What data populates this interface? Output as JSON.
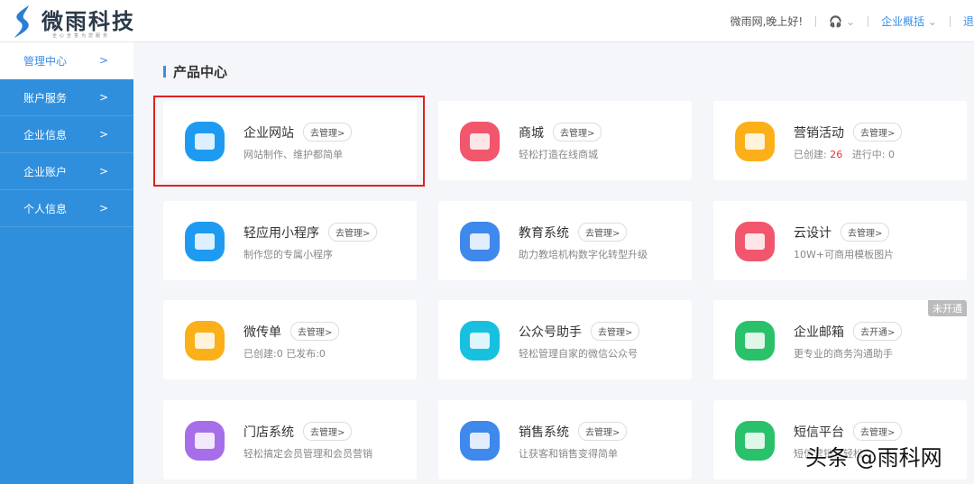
{
  "header": {
    "logo_text": "微雨科技",
    "logo_sub": "全心全意为您服务",
    "greeting": "微雨网,晚上好!",
    "overview": "企业概括",
    "logout": "退"
  },
  "sidebar": {
    "items": [
      {
        "label": "管理中心",
        "active": true
      },
      {
        "label": "账户服务"
      },
      {
        "label": "企业信息"
      },
      {
        "label": "企业账户"
      },
      {
        "label": "个人信息"
      }
    ]
  },
  "main": {
    "title": "产品中心",
    "cards": [
      {
        "title": "企业网站",
        "action": "去管理>",
        "desc": "网站制作、维护都简单",
        "color": "#1e9bf0",
        "highlighted": true
      },
      {
        "title": "商城",
        "action": "去管理>",
        "desc": "轻松打造在线商城",
        "color": "#f2566c"
      },
      {
        "title": "营销活动",
        "action": "去管理>",
        "desc_pre": "已创建:",
        "count1": "26",
        "desc_mid": "进行中:",
        "count2": "0",
        "color": "#fbaf18"
      },
      {
        "title": "轻应用小程序",
        "action": "去管理>",
        "desc": "制作您的专属小程序",
        "color": "#1e9bf0"
      },
      {
        "title": "教育系统",
        "action": "去管理>",
        "desc": "助力教培机构数字化转型升级",
        "color": "#3f88ec"
      },
      {
        "title": "云设计",
        "action": "去管理>",
        "desc": "10W+可商用模板图片",
        "color": "#f2566c"
      },
      {
        "title": "微传单",
        "action": "去管理>",
        "desc": "已创建:0   已发布:0",
        "color": "#fbaf18"
      },
      {
        "title": "公众号助手",
        "action": "去管理>",
        "desc": "轻松管理自家的微信公众号",
        "color": "#18c0e0"
      },
      {
        "title": "企业邮箱",
        "action": "去开通>",
        "desc": "更专业的商务沟通助手",
        "color": "#29c16a",
        "tag": "未开通"
      },
      {
        "title": "门店系统",
        "action": "去管理>",
        "desc": "轻松搞定会员管理和会员营销",
        "color": "#a66ee8"
      },
      {
        "title": "销售系统",
        "action": "去管理>",
        "desc": "让获客和销售变得简单",
        "color": "#3f88ec"
      },
      {
        "title": "短信平台",
        "action": "去管理>",
        "desc": "短信营销更轻松",
        "color": "#29c16a"
      }
    ]
  },
  "watermark": "头条 @雨科网"
}
